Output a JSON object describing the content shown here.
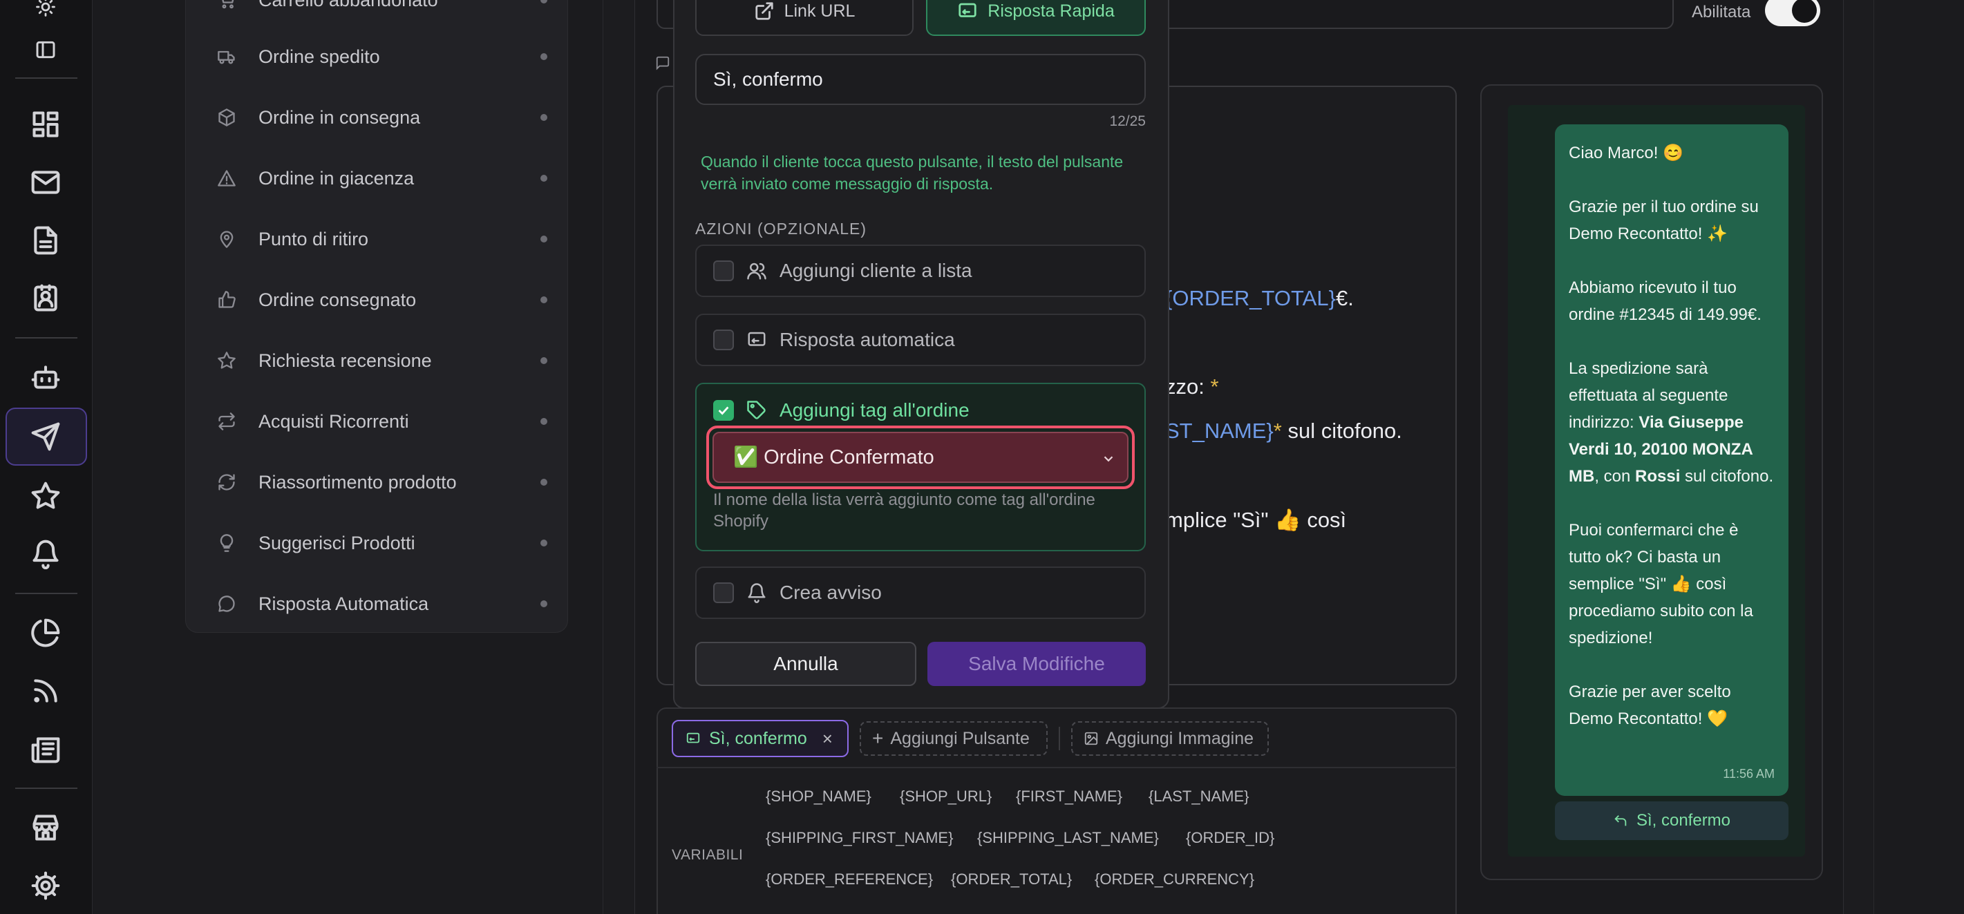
{
  "sidebar_templates": {
    "items": [
      {
        "label": "Carrello abbandonato",
        "icon": "cart-icon"
      },
      {
        "label": "Ordine spedito",
        "icon": "truck-icon"
      },
      {
        "label": "Ordine in consegna",
        "icon": "package-icon"
      },
      {
        "label": "Ordine in giacenza",
        "icon": "warning-icon"
      },
      {
        "label": "Punto di ritiro",
        "icon": "map-pin-icon"
      },
      {
        "label": "Ordine consegnato",
        "icon": "thumbs-up-icon"
      },
      {
        "label": "Richiesta recensione",
        "icon": "star-icon"
      },
      {
        "label": "Acquisti Ricorrenti",
        "icon": "repeat-icon"
      },
      {
        "label": "Riassortimento prodotto",
        "icon": "refresh-icon"
      },
      {
        "label": "Suggerisci Prodotti",
        "icon": "lightbulb-icon"
      },
      {
        "label": "Risposta Automatica",
        "icon": "chat-icon"
      }
    ]
  },
  "header": {
    "toggle_label": "Abilitata",
    "toggle_on": true
  },
  "modal": {
    "tab_link": "Link URL",
    "tab_quick_reply": "Risposta Rapida",
    "button_text_value": "Sì, confermo",
    "counter": "12/25",
    "hint": "Quando il cliente tocca questo pulsante, il testo del pulsante verrà inviato come messaggio di risposta.",
    "actions_title": "AZIONI (OPZIONALE)",
    "actions": {
      "add_to_list": "Aggiungi cliente a lista",
      "auto_reply": "Risposta automatica",
      "add_tag": "Aggiungi tag all'ordine",
      "create_alert": "Crea avviso"
    },
    "tag_select_value": "✅ Ordine Confermato",
    "tag_hint": "Il nome della lista verrà aggiunto come tag all'ordine Shopify",
    "cancel": "Annulla",
    "save": "Salva Modifiche"
  },
  "editor_fragments": {
    "order_total_var": "{ORDER_TOTAL}",
    "euro": "€.",
    "address_tail": "zzo: ",
    "star": "*",
    "last_name_var": "ST_NAME}",
    "citofono": " sul citofono.",
    "semplice": "mplice \"Sì\" 👍 così"
  },
  "buttons_bar": {
    "quick_reply_chip": "Sì, confermo",
    "add_button": "Aggiungi Pulsante",
    "add_image": "Aggiungi Immagine"
  },
  "variables": {
    "label": "VARIABILI",
    "items": [
      "{SHOP_NAME}",
      "{SHOP_URL}",
      "{FIRST_NAME}",
      "{LAST_NAME}",
      "{SHIPPING_FIRST_NAME}",
      "{SHIPPING_LAST_NAME}",
      "{ORDER_ID}",
      "{ORDER_REFERENCE}",
      "{ORDER_TOTAL}",
      "{ORDER_CURRENCY}"
    ]
  },
  "preview": {
    "p1": "Ciao Marco! 😊",
    "p2": "Grazie per il tuo ordine su Demo Recontatto! ✨",
    "p3": "Abbiamo ricevuto il tuo ordine #12345 di 149.99€.",
    "p4_a": "La spedizione sarà effettuata al seguente indirizzo: ",
    "p4_b": "Via Giuseppe Verdi 10, 20100 MONZA MB",
    "p4_c": ", con ",
    "p4_d": "Rossi",
    "p4_e": " sul citofono.",
    "p5": "Puoi confermarci che è tutto ok? Ci basta un semplice \"Sì\" 👍 così procediamo subito con la spedizione!",
    "p6": "Grazie per aver scelto Demo Recontatto! 💛",
    "time": "11:56 AM",
    "quick_reply": "Sì, confermo"
  }
}
